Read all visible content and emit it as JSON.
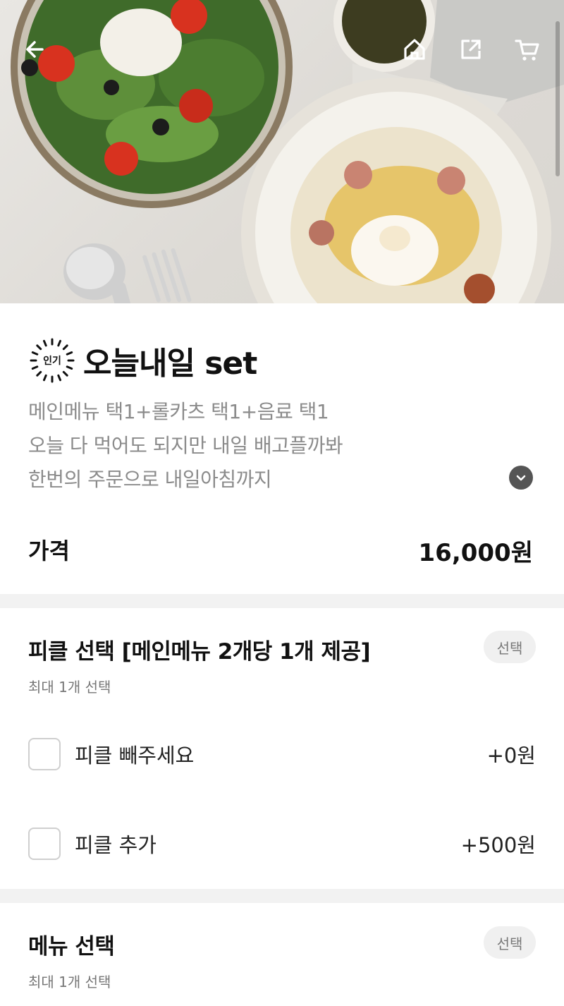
{
  "nav": {
    "back": "back-arrow-icon",
    "home": "home-icon",
    "share": "share-icon",
    "cart": "cart-icon"
  },
  "product": {
    "badge": "인기",
    "title": "오늘내일 set",
    "description": [
      "메인메뉴 택1+롤카츠 택1+음료 택1",
      "오늘 다 먹어도 되지만 내일 배고플까봐",
      "한번의 주문으로 내일아침까지"
    ],
    "price_label": "가격",
    "price_value": "16,000원"
  },
  "sections": [
    {
      "title": "피클 선택 [메인메뉴 2개당 1개 제공]",
      "subtitle": "최대 1개 선택",
      "chip": "선택",
      "options": [
        {
          "label": "피클 빼주세요",
          "price": "+0원",
          "checked": false
        },
        {
          "label": "피클 추가",
          "price": "+500원",
          "checked": false
        }
      ]
    },
    {
      "title": "메뉴 선택",
      "subtitle": "최대 1개 선택",
      "chip": "선택"
    }
  ],
  "colors": {
    "subtext": "#8b8b8b",
    "separator": "#f2f2f2",
    "chip_bg": "#f0f0f0"
  }
}
